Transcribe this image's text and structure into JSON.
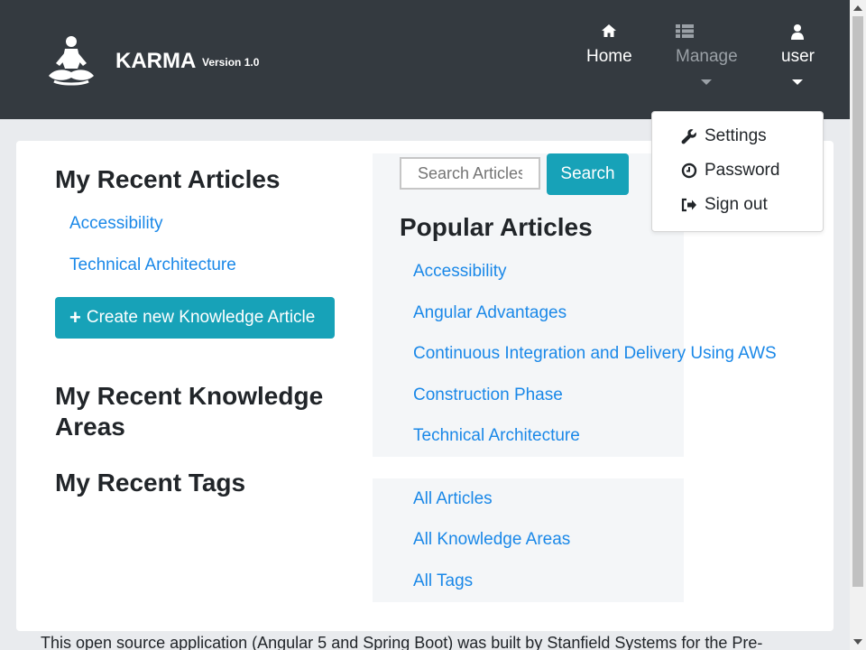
{
  "navbar": {
    "brand_name": "KARMA",
    "brand_version": "Version 1.0",
    "items": [
      {
        "icon": "home-icon",
        "label": "Home"
      },
      {
        "icon": "list-icon",
        "label": "Manage"
      },
      {
        "icon": "user-icon",
        "label": "user"
      }
    ]
  },
  "user_menu": {
    "items": [
      {
        "icon": "wrench-icon",
        "label": "Settings"
      },
      {
        "icon": "clock-icon",
        "label": "Password"
      },
      {
        "icon": "sign-out-icon",
        "label": "Sign out"
      }
    ]
  },
  "recent_articles": {
    "title": "My Recent Articles",
    "items": [
      "Accessibility",
      "Technical Architecture"
    ]
  },
  "create_button": {
    "label": "Create new Knowledge Article"
  },
  "recent_knowledge_areas": {
    "title_line1": "My Recent Knowledge",
    "title_line2": "Areas"
  },
  "recent_tags": {
    "title": "My Recent Tags"
  },
  "search": {
    "placeholder": "Search Articles",
    "button_label": "Search"
  },
  "popular_articles": {
    "title": "Popular Articles",
    "items": [
      "Accessibility",
      "Angular Advantages",
      "Continuous Integration and Delivery Using AWS",
      "Construction Phase",
      "Technical Architecture"
    ]
  },
  "browse_links": {
    "items": [
      "All Articles",
      "All Knowledge Areas",
      "All Tags"
    ]
  },
  "footer": {
    "text": "This open source application (Angular 5 and Spring Boot) was built by Stanfield Systems for the Pre-"
  },
  "colors": {
    "navbar": "#343a40",
    "accent": "#17a2b8",
    "link": "#1a88e8"
  }
}
